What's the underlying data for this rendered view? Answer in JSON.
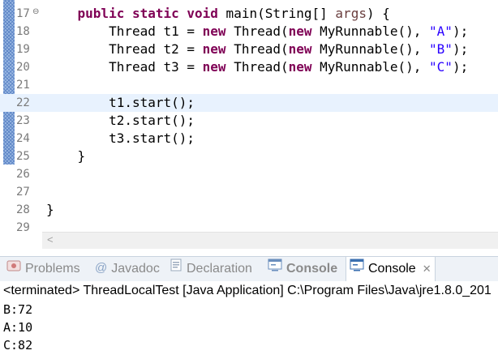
{
  "editor": {
    "lines": [
      {
        "num": "17",
        "fold": "⊖",
        "segments": [
          {
            "t": "    "
          },
          {
            "t": "public static void",
            "c": "kw"
          },
          {
            "t": " main(String[] "
          },
          {
            "t": "args",
            "c": "param"
          },
          {
            "t": ") {"
          }
        ]
      },
      {
        "num": "18",
        "segments": [
          {
            "t": "        Thread t1 = "
          },
          {
            "t": "new",
            "c": "kw"
          },
          {
            "t": " Thread("
          },
          {
            "t": "new",
            "c": "kw"
          },
          {
            "t": " MyRunnable(), "
          },
          {
            "t": "\"A\"",
            "c": "str"
          },
          {
            "t": ");"
          }
        ]
      },
      {
        "num": "19",
        "segments": [
          {
            "t": "        Thread t2 = "
          },
          {
            "t": "new",
            "c": "kw"
          },
          {
            "t": " Thread("
          },
          {
            "t": "new",
            "c": "kw"
          },
          {
            "t": " MyRunnable(), "
          },
          {
            "t": "\"B\"",
            "c": "str"
          },
          {
            "t": ");"
          }
        ]
      },
      {
        "num": "20",
        "segments": [
          {
            "t": "        Thread t3 = "
          },
          {
            "t": "new",
            "c": "kw"
          },
          {
            "t": " Thread("
          },
          {
            "t": "new",
            "c": "kw"
          },
          {
            "t": " MyRunnable(), "
          },
          {
            "t": "\"C\"",
            "c": "str"
          },
          {
            "t": ");"
          }
        ]
      },
      {
        "num": "21",
        "segments": []
      },
      {
        "num": "22",
        "current": true,
        "segments": [
          {
            "t": "        t1.start();"
          }
        ]
      },
      {
        "num": "23",
        "segments": [
          {
            "t": "        t2.start();"
          }
        ]
      },
      {
        "num": "24",
        "segments": [
          {
            "t": "        t3.start();"
          }
        ]
      },
      {
        "num": "25",
        "segments": [
          {
            "t": "    }"
          }
        ]
      },
      {
        "num": "26",
        "segments": []
      },
      {
        "num": "27",
        "segments": []
      },
      {
        "num": "28",
        "segments": [
          {
            "t": "}"
          }
        ]
      },
      {
        "num": "29",
        "segments": []
      }
    ],
    "scroll_left_glyph": "<"
  },
  "tabs": [
    {
      "label": "Problems",
      "icon": "problems-icon",
      "active": false
    },
    {
      "label": "Javadoc",
      "icon": "at-icon",
      "active": false
    },
    {
      "label": "Declaration",
      "icon": "declaration-icon",
      "active": false
    },
    {
      "label": "Console",
      "icon": "console-icon",
      "active": false,
      "bold": true
    },
    {
      "label": "Console",
      "icon": "console-icon",
      "active": true
    }
  ],
  "console": {
    "status": "<terminated> ThreadLocalTest [Java Application] C:\\Program Files\\Java\\jre1.8.0_201",
    "output": [
      "B:72",
      "A:10",
      "C:82"
    ]
  },
  "colors": {
    "keyword": "#7f0055",
    "string": "#2a00ff",
    "current_line": "#e8f2fe"
  }
}
